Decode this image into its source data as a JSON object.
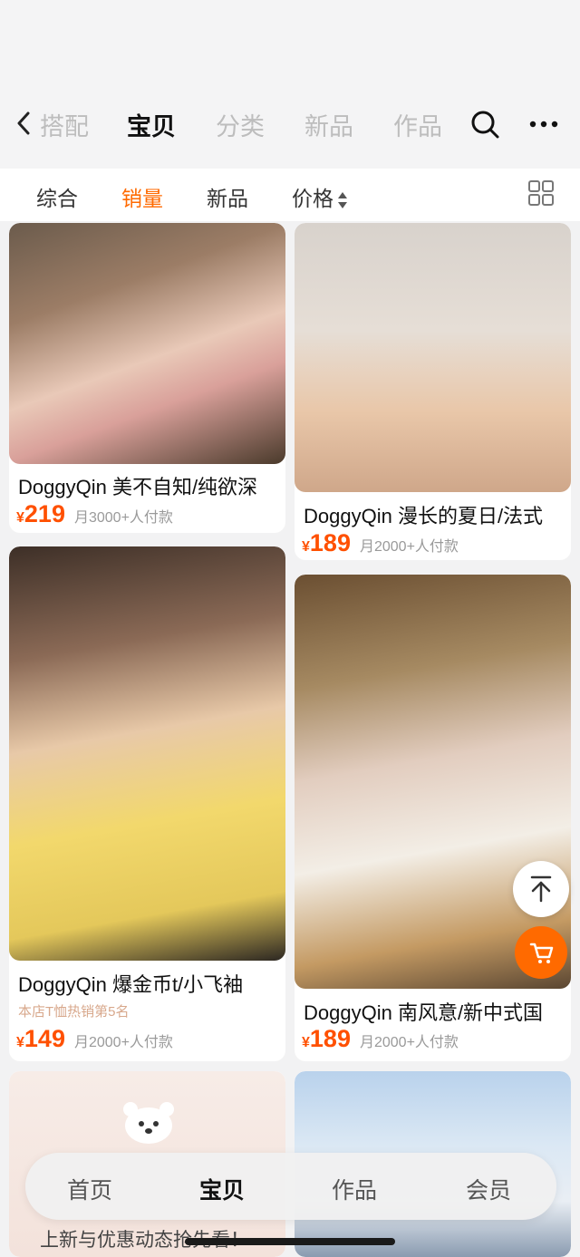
{
  "nav": {
    "tabs": [
      {
        "label": "搭配"
      },
      {
        "label": "宝贝"
      },
      {
        "label": "分类"
      },
      {
        "label": "新品"
      },
      {
        "label": "作品"
      }
    ],
    "icons": [
      "back-arrow-icon",
      "search-icon",
      "more-icon"
    ]
  },
  "sort": {
    "items": [
      {
        "label": "综合"
      },
      {
        "label": "销量"
      },
      {
        "label": "新品"
      },
      {
        "label": "价格"
      }
    ],
    "accent": "#ff6a00"
  },
  "products": [
    {
      "title": "DoggyQin 美不自知/纯欲深",
      "currency": "¥",
      "price": "219",
      "sales": "月3000+人付款"
    },
    {
      "title": "DoggyQin 漫长的夏日/法式",
      "currency": "¥",
      "price": "189",
      "sales": "月2000+人付款"
    },
    {
      "title": "DoggyQin 爆金币t/小飞袖",
      "subtitle": "本店T恤热销第5名",
      "currency": "¥",
      "price": "149",
      "sales": "月2000+人付款"
    },
    {
      "title": "DoggyQin 南风意/新中式国",
      "currency": "¥",
      "price": "189",
      "sales": "月2000+人付款"
    }
  ],
  "bottom_tabs": [
    {
      "label": "首页"
    },
    {
      "label": "宝贝"
    },
    {
      "label": "作品"
    },
    {
      "label": "会员"
    }
  ],
  "promo_text": "上新与优惠动态抢先看！",
  "colors": {
    "price": "#ff5000",
    "cart_button": "#ff6a00"
  }
}
